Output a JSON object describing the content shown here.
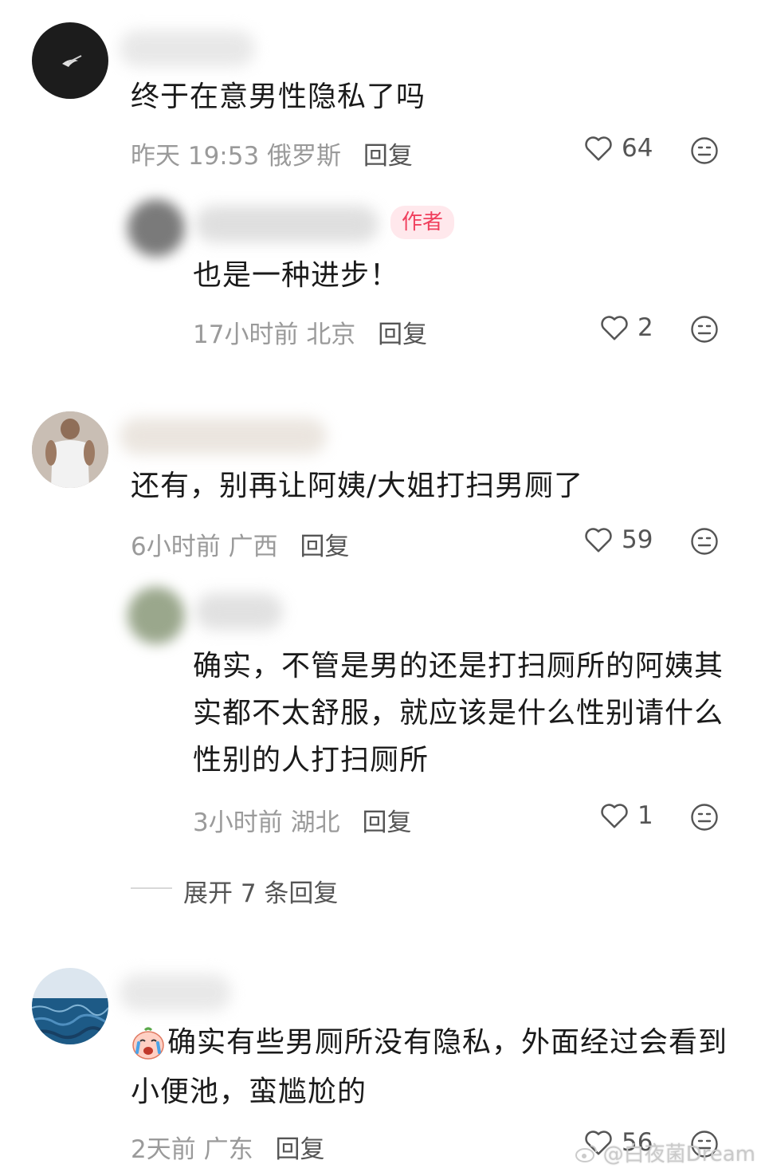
{
  "comments": [
    {
      "text": "终于在意男性隐私了吗",
      "time": "昨天 19:53",
      "location": "俄罗斯",
      "reply_label": "回复",
      "likes": "64",
      "replies": [
        {
          "badge": "作者",
          "text": "也是一种进步！",
          "time": "17小时前",
          "location": "北京",
          "reply_label": "回复",
          "likes": "2"
        }
      ]
    },
    {
      "text": "还有，别再让阿姨/大姐打扫男厕了",
      "time": "6小时前",
      "location": "广西",
      "reply_label": "回复",
      "likes": "59",
      "replies": [
        {
          "text_lines": [
            "确实，不管是男的还是打扫厕所的阿姨其",
            "实都不太舒服，就应该是什么性别请什么",
            "性别的人打扫厕所"
          ],
          "time": "3小时前",
          "location": "湖北",
          "reply_label": "回复",
          "likes": "1"
        }
      ],
      "expand_label": "展开 7 条回复"
    },
    {
      "text_lines": [
        "确实有些男厕所没有隐私，外面经过会看到",
        "小便池，蛮尴尬的"
      ],
      "time": "2天前",
      "location": "广东",
      "reply_label": "回复",
      "likes": "56"
    }
  ],
  "watermark": "@白夜菌Dream",
  "icons": {
    "like": "heart-outline-icon",
    "emoji": "neutral-face-icon",
    "comment_emoji": "crying-face-emoji"
  },
  "colors": {
    "author_badge_bg": "#ffe8ec",
    "author_badge_text": "#f0405e",
    "meta_text": "#9a9a9a"
  }
}
